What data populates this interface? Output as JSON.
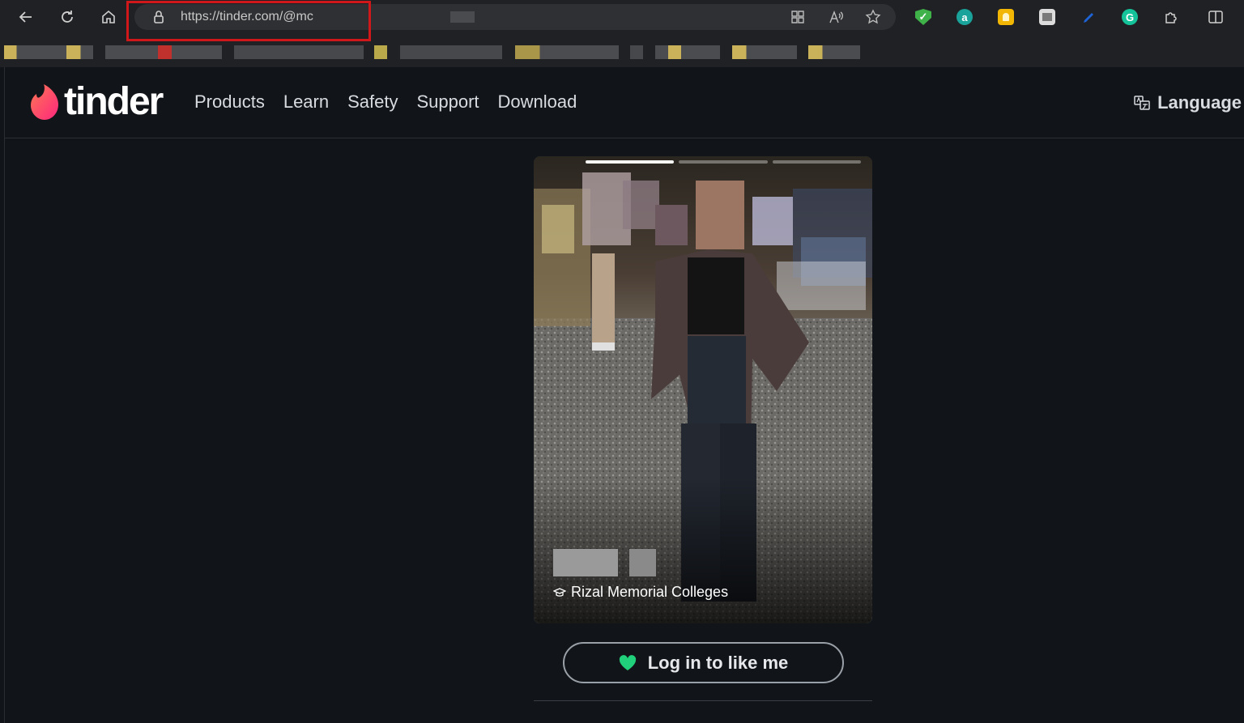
{
  "browser": {
    "url_text": "https://tinder.com/@mc",
    "toolbar_icons": [
      "back-icon",
      "reload-icon",
      "home-icon"
    ],
    "address_icons": [
      "lock-icon",
      "apps-icon",
      "read-aloud-icon",
      "favorite-star-icon"
    ],
    "extensions": [
      {
        "name": "shield-extension-icon",
        "color": "#3fb24a",
        "glyph": "✓"
      },
      {
        "name": "amazon-assistant-icon",
        "color": "#1aa39a",
        "glyph": "a"
      },
      {
        "name": "keep-notes-icon",
        "color": "#f2b705",
        "glyph": ""
      },
      {
        "name": "image-extension-icon",
        "color": "#dcdcdc",
        "glyph": ""
      },
      {
        "name": "pen-extension-icon",
        "color": "#1d63d6",
        "glyph": "/"
      },
      {
        "name": "grammarly-icon",
        "color": "#15c39a",
        "glyph": "G"
      },
      {
        "name": "extensions-puzzle-icon",
        "color": "#202124",
        "glyph": ""
      },
      {
        "name": "split-screen-icon",
        "color": "#202124",
        "glyph": ""
      }
    ]
  },
  "brand": {
    "wordmark": "tinder",
    "accent": "#fd5068"
  },
  "nav": {
    "links": [
      "Products",
      "Learn",
      "Safety",
      "Support",
      "Download"
    ],
    "language_label": "Language"
  },
  "profile": {
    "photo_count": 3,
    "active_photo": 1,
    "school": "Rizal Memorial Colleges"
  },
  "cta": {
    "like_label": "Log in to like me",
    "heart_color": "#21d07a"
  }
}
